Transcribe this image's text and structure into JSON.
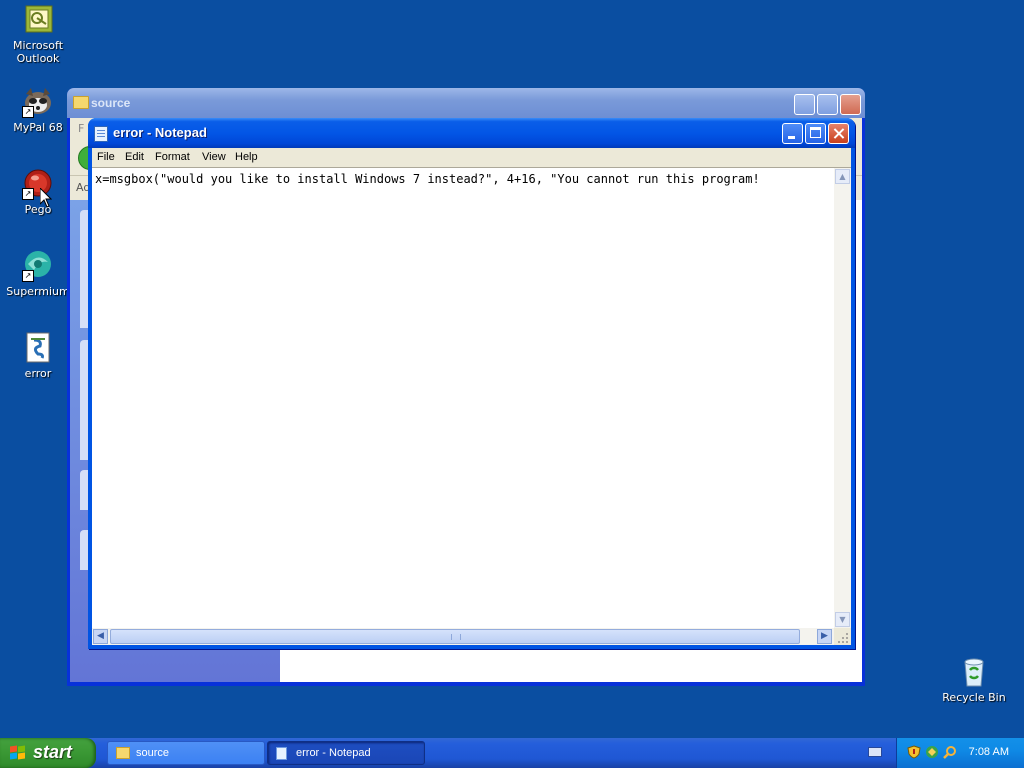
{
  "desktop": {
    "icons": [
      {
        "label": "Microsoft\nOutlook",
        "icon": "outlook-icon"
      },
      {
        "label": "MyPal 68",
        "icon": "mypal-icon"
      },
      {
        "label": "Pego",
        "icon": "pego-icon"
      },
      {
        "label": "Supermium",
        "icon": "supermium-icon"
      },
      {
        "label": "error",
        "icon": "script-file-icon"
      },
      {
        "label": "Recycle Bin",
        "icon": "recycle-bin-icon"
      }
    ]
  },
  "source_window": {
    "title": "source",
    "menu_hint": "F",
    "address_hint": "Ad"
  },
  "notepad": {
    "title": "error - Notepad",
    "menu": [
      "File",
      "Edit",
      "Format",
      "View",
      "Help"
    ],
    "content": "x=msgbox(\"would you like to install Windows 7 instead?\", 4+16, \"You cannot run this program!"
  },
  "taskbar": {
    "start_label": "start",
    "tasks": [
      {
        "label": "source",
        "icon": "folder-icon"
      },
      {
        "label": "error - Notepad",
        "icon": "notepad-icon"
      }
    ],
    "clock": "7:08 AM"
  },
  "colors": {
    "desktop": "#0a4ea1",
    "titlebar_active": "#0054e3",
    "start_green": "#3c9a36"
  }
}
